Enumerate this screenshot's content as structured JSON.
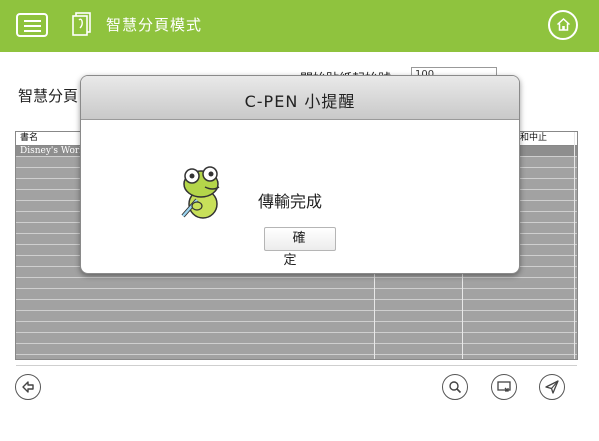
{
  "app": {
    "title": "智慧分頁模式"
  },
  "form": {
    "page_label": "智慧分頁",
    "start_label": "開始貼紙起始號",
    "start_value": "100"
  },
  "table": {
    "headers": [
      "書名",
      "",
      "和中止"
    ],
    "rows": [
      {
        "title": "Disney's World",
        "selected": true
      },
      {
        "title": "",
        "selected": false
      },
      {
        "title": "",
        "selected": false
      },
      {
        "title": "",
        "selected": false
      },
      {
        "title": "",
        "selected": false
      },
      {
        "title": "",
        "selected": false
      },
      {
        "title": "",
        "selected": false
      },
      {
        "title": "",
        "selected": false
      },
      {
        "title": "",
        "selected": false
      },
      {
        "title": "",
        "selected": false
      },
      {
        "title": "",
        "selected": false
      },
      {
        "title": "",
        "selected": false
      },
      {
        "title": "",
        "selected": false
      },
      {
        "title": "",
        "selected": false
      },
      {
        "title": "",
        "selected": false
      },
      {
        "title": "",
        "selected": false
      },
      {
        "title": "",
        "selected": false
      },
      {
        "title": "",
        "selected": false
      },
      {
        "title": "",
        "selected": false
      },
      {
        "title": "",
        "selected": false
      }
    ]
  },
  "dialog": {
    "title": "C-PEN 小提醒",
    "message": "傳輸完成",
    "ok_label": "確定"
  },
  "icons": {
    "menu": "menu-icon",
    "doc": "document-icon",
    "home": "home-icon",
    "back": "back-arrow-icon",
    "search": "search-icon",
    "export": "export-icon",
    "send": "send-icon",
    "mascot": "frog-mascot-icon"
  },
  "colors": {
    "accent": "#8fc33e",
    "table_bg": "#a2a2a2"
  }
}
